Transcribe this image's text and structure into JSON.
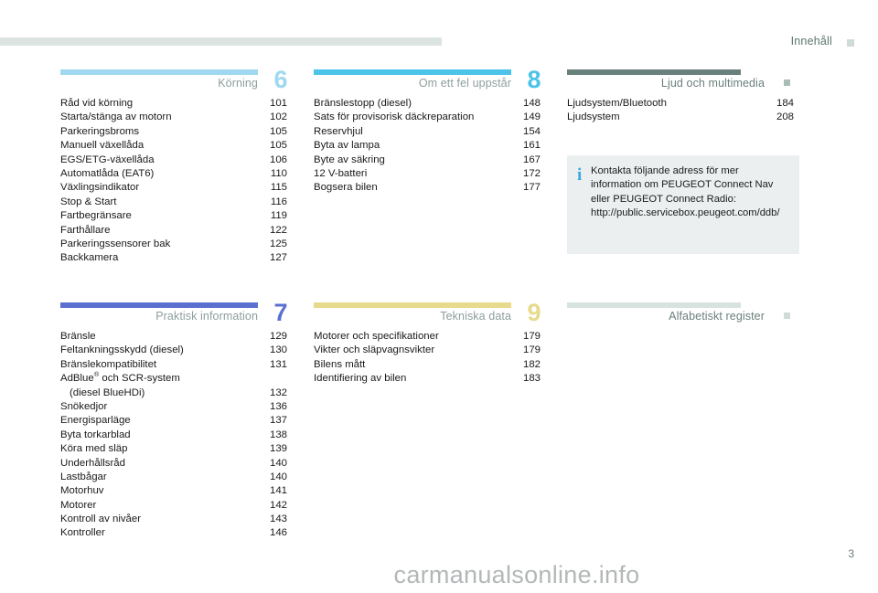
{
  "header": {
    "title": "Innehåll",
    "square_color": "#cfdbd7",
    "rule_color": "#dbe4e1"
  },
  "blocks": [
    {
      "id": "korning",
      "title": "Körning",
      "number": "6",
      "accent": "#9fd8f0",
      "entries": [
        {
          "label": "Råd vid körning",
          "page": "101"
        },
        {
          "label": "Starta/stänga av motorn",
          "page": "102"
        },
        {
          "label": "Parkeringsbroms",
          "page": "105"
        },
        {
          "label": "Manuell växellåda",
          "page": "105"
        },
        {
          "label": "EGS/ETG-växellåda",
          "page": "106"
        },
        {
          "label": "Automatlåda (EAT6)",
          "page": "110"
        },
        {
          "label": "Växlingsindikator",
          "page": "115"
        },
        {
          "label": "Stop & Start",
          "page": "116"
        },
        {
          "label": "Fartbegränsare",
          "page": "119"
        },
        {
          "label": "Farthållare",
          "page": "122"
        },
        {
          "label": "Parkeringssensorer bak",
          "page": "125"
        },
        {
          "label": "Backkamera",
          "page": "127"
        }
      ]
    },
    {
      "id": "om-ett-fel-uppstar",
      "title": "Om ett fel uppstår",
      "number": "8",
      "accent": "#4cc3e8",
      "entries": [
        {
          "label": "Bränslestopp (diesel)",
          "page": "148"
        },
        {
          "label": "Sats för provisorisk däckreparation",
          "page": "149"
        },
        {
          "label": "Reservhjul",
          "page": "154"
        },
        {
          "label": "Byta av lampa",
          "page": "161"
        },
        {
          "label": "Byte av säkring",
          "page": "167"
        },
        {
          "label": "12 V-batteri",
          "page": "172"
        },
        {
          "label": "Bogsera bilen",
          "page": "177"
        }
      ]
    },
    {
      "id": "ljud-och-multimedia",
      "title": "Ljud och multimedia",
      "number": "",
      "accent": "#69807c",
      "entries": [
        {
          "label": "Ljudsystem/Bluetooth",
          "page": "184"
        },
        {
          "label": "Ljudsystem",
          "page": "208"
        }
      ]
    },
    {
      "id": "praktisk-information",
      "title": "Praktisk information",
      "number": "7",
      "accent": "#5b6fd0",
      "entries": [
        {
          "label": "Bränsle",
          "page": "129"
        },
        {
          "label": "Feltankningsskydd (diesel)",
          "page": "130"
        },
        {
          "label": "Bränslekompatibilitet",
          "page": "131"
        },
        {
          "label": "AdBlue® och SCR-system",
          "page": ""
        },
        {
          "label": "(diesel BlueHDi)",
          "page": "132",
          "indent": true
        },
        {
          "label": "Snökedjor",
          "page": "136"
        },
        {
          "label": "Energisparläge",
          "page": "137"
        },
        {
          "label": "Byta torkarblad",
          "page": "138"
        },
        {
          "label": "Köra med släp",
          "page": "139"
        },
        {
          "label": "Underhållsråd",
          "page": "140"
        },
        {
          "label": "Lastbågar",
          "page": "140"
        },
        {
          "label": "Motorhuv",
          "page": "141"
        },
        {
          "label": "Motorer",
          "page": "142"
        },
        {
          "label": "Kontroll av nivåer",
          "page": "143"
        },
        {
          "label": "Kontroller",
          "page": "146"
        }
      ]
    },
    {
      "id": "tekniska-data",
      "title": "Tekniska data",
      "number": "9",
      "accent": "#e6da8c",
      "entries": [
        {
          "label": "Motorer och specifikationer",
          "page": "179"
        },
        {
          "label": "Vikter och släpvagnsvikter",
          "page": "179"
        },
        {
          "label": "Bilens mått",
          "page": "182"
        },
        {
          "label": "Identifiering av bilen",
          "page": "183"
        }
      ]
    },
    {
      "id": "alfabetiskt-register",
      "title": "Alfabetiskt register",
      "number": "",
      "accent": "#d7e3df",
      "entries": []
    }
  ],
  "info_box": {
    "icon": "info-icon",
    "text": "Kontakta följande adress för mer information om PEUGEOT Connect Nav eller PEUGEOT Connect Radio: http://public.servicebox.peugeot.com/ddb/",
    "background": "#eceff0",
    "icon_color": "#3ba9e0"
  },
  "footer": {
    "page_number": "3",
    "watermark": "carmanualsonline.info"
  }
}
